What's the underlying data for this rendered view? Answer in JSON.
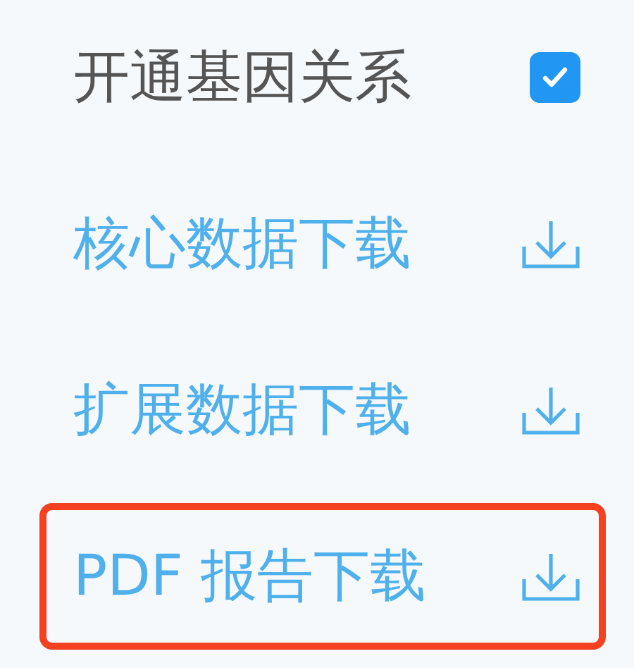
{
  "items": [
    {
      "kind": "checkbox",
      "label": "开通基因关系",
      "checked": true,
      "highlighted": false
    },
    {
      "kind": "download",
      "label": "核心数据下载",
      "highlighted": false
    },
    {
      "kind": "download",
      "label": "扩展数据下载",
      "highlighted": false
    },
    {
      "kind": "download",
      "label": "PDF 报告下载",
      "highlighted": true
    }
  ]
}
